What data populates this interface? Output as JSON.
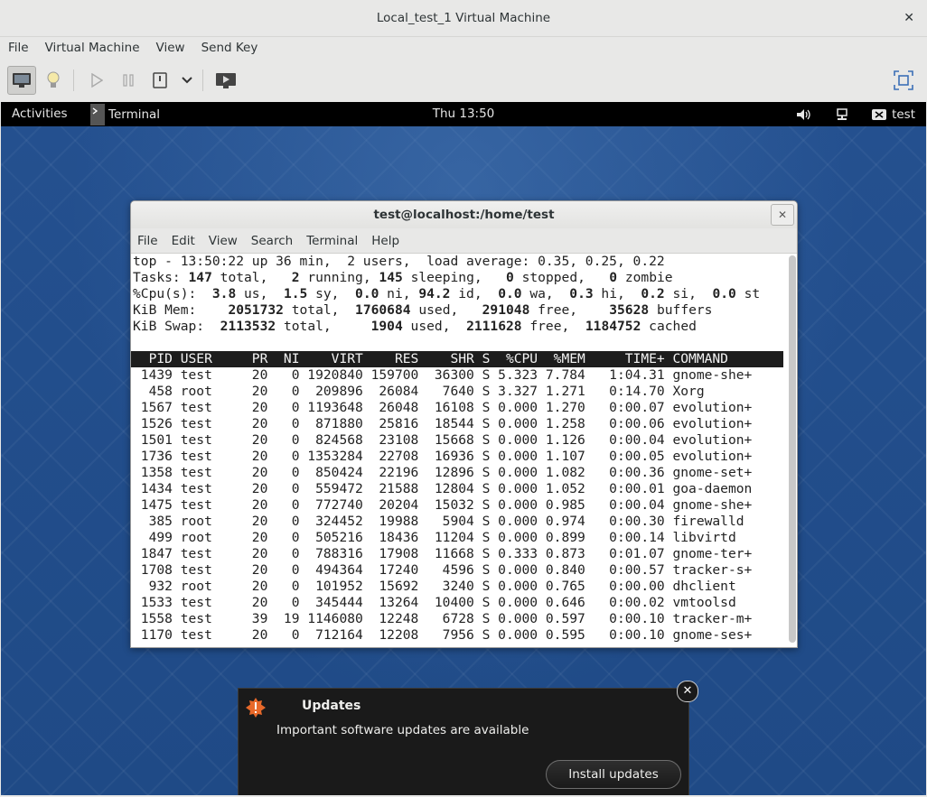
{
  "window": {
    "title": "Local_test_1 Virtual Machine",
    "close_icon": "close-icon"
  },
  "menubar": {
    "items": [
      "File",
      "Virtual Machine",
      "View",
      "Send Key"
    ]
  },
  "gnome": {
    "activities": "Activities",
    "app_name": "Terminal",
    "clock": "Thu 13:50",
    "user": "test"
  },
  "terminal": {
    "title": "test@localhost:/home/test",
    "menu": [
      "File",
      "Edit",
      "View",
      "Search",
      "Terminal",
      "Help"
    ],
    "top_summary": {
      "line1": "top - 13:50:22 up 36 min,  2 users,  load average: 0.35, 0.25, 0.22",
      "tasks": {
        "label": "Tasks:",
        "total": "147",
        "running": "2",
        "sleeping": "145",
        "stopped": "0",
        "zombie": "0"
      },
      "cpu": {
        "label": "%Cpu(s):",
        "us": "3.8",
        "sy": "1.5",
        "ni": "0.0",
        "id": "94.2",
        "wa": "0.0",
        "hi": "0.3",
        "si": "0.2",
        "st": "0.0"
      },
      "mem": {
        "label": "KiB Mem:",
        "total": "2051732",
        "used": "1760684",
        "free": "291048",
        "buffers": "35628"
      },
      "swap": {
        "label": "KiB Swap:",
        "total": "2113532",
        "used": "1904",
        "free": "2111628",
        "cached": "1184752"
      }
    },
    "columns": [
      "PID",
      "USER",
      "PR",
      "NI",
      "VIRT",
      "RES",
      "SHR",
      "S",
      "%CPU",
      "%MEM",
      "TIME+",
      "COMMAND"
    ],
    "processes": [
      [
        "1439",
        "test",
        "20",
        "0",
        "1920840",
        "159700",
        "36300",
        "S",
        "5.323",
        "7.784",
        "1:04.31",
        "gnome-she+"
      ],
      [
        "458",
        "root",
        "20",
        "0",
        "209896",
        "26084",
        "7640",
        "S",
        "3.327",
        "1.271",
        "0:14.70",
        "Xorg"
      ],
      [
        "1567",
        "test",
        "20",
        "0",
        "1193648",
        "26048",
        "16108",
        "S",
        "0.000",
        "1.270",
        "0:00.07",
        "evolution+"
      ],
      [
        "1526",
        "test",
        "20",
        "0",
        "871880",
        "25816",
        "18544",
        "S",
        "0.000",
        "1.258",
        "0:00.06",
        "evolution+"
      ],
      [
        "1501",
        "test",
        "20",
        "0",
        "824568",
        "23108",
        "15668",
        "S",
        "0.000",
        "1.126",
        "0:00.04",
        "evolution+"
      ],
      [
        "1736",
        "test",
        "20",
        "0",
        "1353284",
        "22708",
        "16936",
        "S",
        "0.000",
        "1.107",
        "0:00.05",
        "evolution+"
      ],
      [
        "1358",
        "test",
        "20",
        "0",
        "850424",
        "22196",
        "12896",
        "S",
        "0.000",
        "1.082",
        "0:00.36",
        "gnome-set+"
      ],
      [
        "1434",
        "test",
        "20",
        "0",
        "559472",
        "21588",
        "12804",
        "S",
        "0.000",
        "1.052",
        "0:00.01",
        "goa-daemon"
      ],
      [
        "1475",
        "test",
        "20",
        "0",
        "772740",
        "20204",
        "15032",
        "S",
        "0.000",
        "0.985",
        "0:00.04",
        "gnome-she+"
      ],
      [
        "385",
        "root",
        "20",
        "0",
        "324452",
        "19988",
        "5904",
        "S",
        "0.000",
        "0.974",
        "0:00.30",
        "firewalld"
      ],
      [
        "499",
        "root",
        "20",
        "0",
        "505216",
        "18436",
        "11204",
        "S",
        "0.000",
        "0.899",
        "0:00.14",
        "libvirtd"
      ],
      [
        "1847",
        "test",
        "20",
        "0",
        "788316",
        "17908",
        "11668",
        "S",
        "0.333",
        "0.873",
        "0:01.07",
        "gnome-ter+"
      ],
      [
        "1708",
        "test",
        "20",
        "0",
        "494364",
        "17240",
        "4596",
        "S",
        "0.000",
        "0.840",
        "0:00.57",
        "tracker-s+"
      ],
      [
        "932",
        "root",
        "20",
        "0",
        "101952",
        "15692",
        "3240",
        "S",
        "0.000",
        "0.765",
        "0:00.00",
        "dhclient"
      ],
      [
        "1533",
        "test",
        "20",
        "0",
        "345444",
        "13264",
        "10400",
        "S",
        "0.000",
        "0.646",
        "0:00.02",
        "vmtoolsd"
      ],
      [
        "1558",
        "test",
        "39",
        "19",
        "1146080",
        "12248",
        "6728",
        "S",
        "0.000",
        "0.597",
        "0:00.10",
        "tracker-m+"
      ],
      [
        "1170",
        "test",
        "20",
        "0",
        "712164",
        "12208",
        "7956",
        "S",
        "0.000",
        "0.595",
        "0:00.10",
        "gnome-ses+"
      ]
    ]
  },
  "notification": {
    "title": "Updates",
    "body": "Important software updates are available",
    "button": "Install updates"
  }
}
